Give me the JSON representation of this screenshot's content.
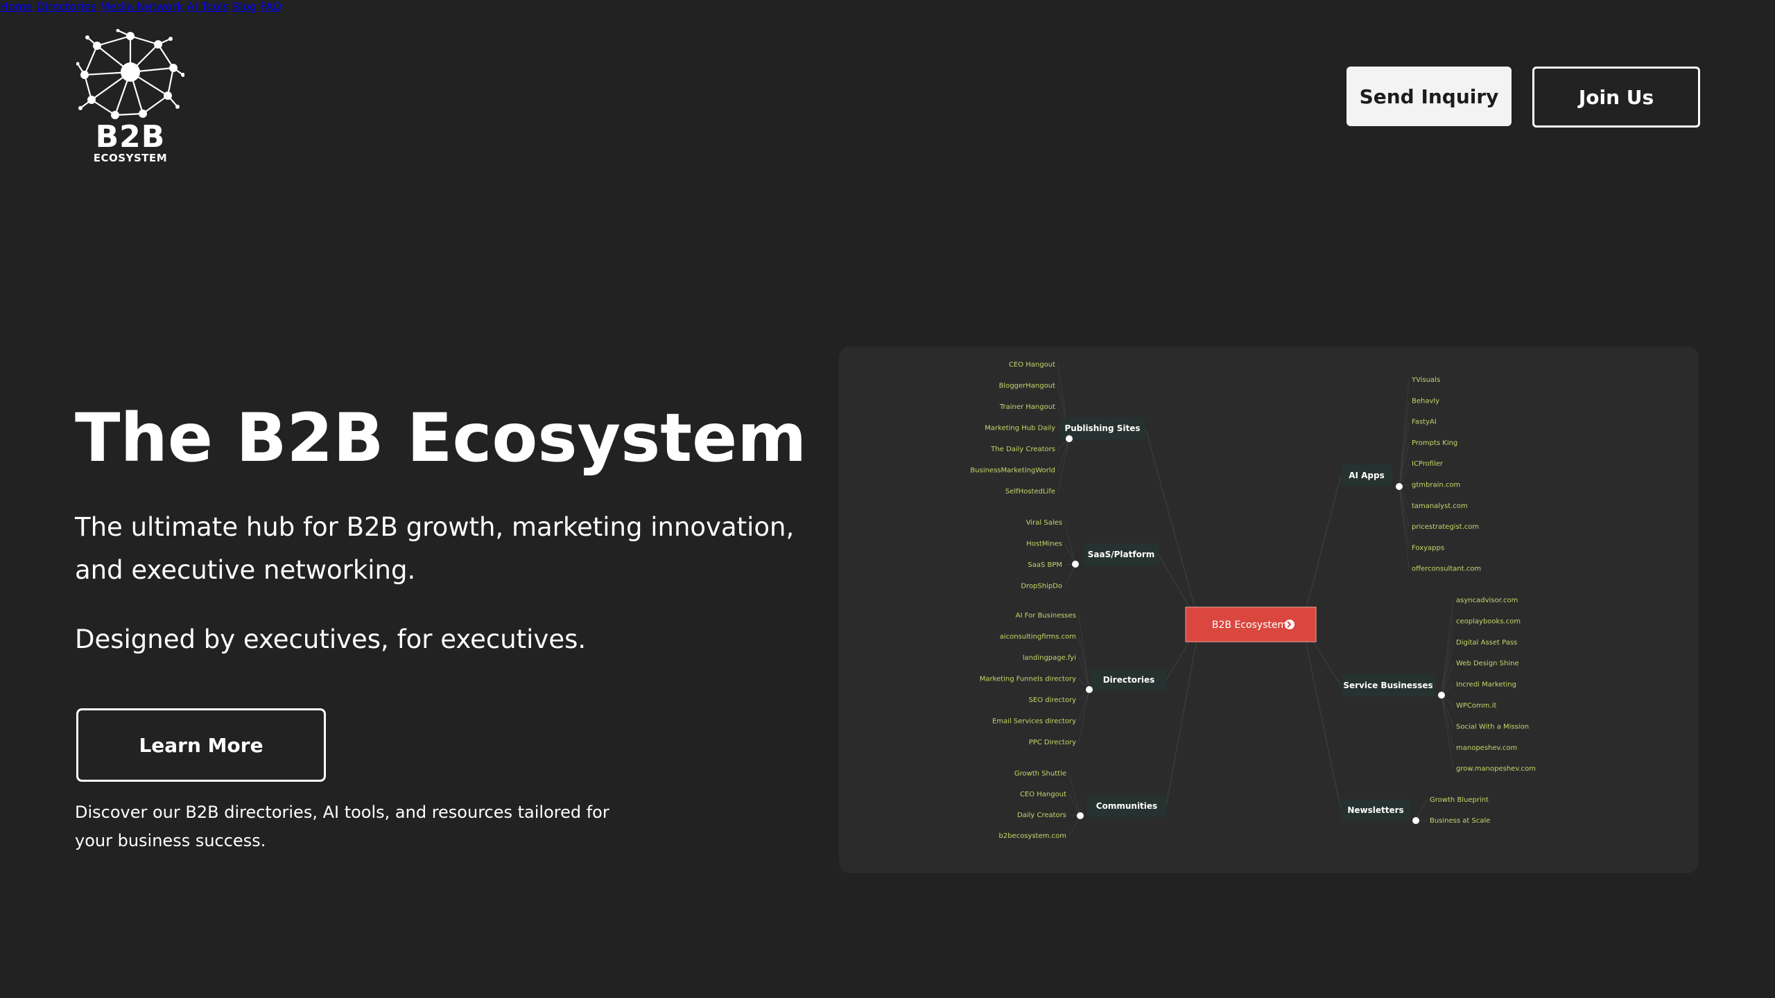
{
  "brand": {
    "name": "B2B",
    "subtitle": "ECOSYSTEM"
  },
  "nav": {
    "items": [
      {
        "label": "Home"
      },
      {
        "label": "Directories"
      },
      {
        "label": "Media Network"
      },
      {
        "label": "AI Tools"
      },
      {
        "label": "Blog"
      },
      {
        "label": "FAQ"
      }
    ],
    "send_inquiry_label": "Send Inquiry",
    "join_label": "Join Us"
  },
  "hero": {
    "title": "The B2B Ecosystem",
    "subtitle": "The ultimate hub for B2B growth, marketing innovation, and executive networking.",
    "tagline": "Designed by executives, for executives.",
    "learn_more_label": "Learn More",
    "discover_text": "Discover our B2B directories, AI tools, and resources tailored for your business success."
  },
  "mindmap": {
    "center": "B2B Ecosystem",
    "center_color": "#d9473f",
    "leaf_color": "#c8d66a",
    "categories": [
      {
        "name": "Publishing Sites",
        "items": [
          "CEO Hangout",
          "BloggerHangout",
          "Trainer Hangout",
          "Marketing Hub Daily",
          "The Daily Creators",
          "BusinessMarketingWorld",
          "SelfHostedLife"
        ]
      },
      {
        "name": "SaaS/Platform",
        "items": [
          "Viral Sales",
          "HostMines",
          "SaaS BPM",
          "DropShipDo"
        ]
      },
      {
        "name": "Directories",
        "items": [
          "AI For Businesses",
          "aiconsultingfirms.com",
          "landingpage.fyi",
          "Marketing Funnels directory",
          "SEO directory",
          "Email Services directory",
          "PPC Directory"
        ]
      },
      {
        "name": "Communities",
        "items": [
          "Growth Shuttle",
          "CEO Hangout",
          "Daily Creators",
          "b2becosystem.com"
        ]
      },
      {
        "name": "AI Apps",
        "items": [
          "YVisuals",
          "Behavly",
          "FastyAI",
          "Prompts King",
          "ICProfiler",
          "gtmbrain.com",
          "tamanalyst.com",
          "pricestrategist.com",
          "Foxyapps",
          "offerconsultant.com"
        ]
      },
      {
        "name": "Service Businesses",
        "items": [
          "asyncadvisor.com",
          "ceoplaybooks.com",
          "Digital Asset Pass",
          "Web Design Shine",
          "Incredi Marketing",
          "WPComm.it",
          "Social With a Mission",
          "manopeshev.com",
          "grow.manopeshev.com"
        ]
      },
      {
        "name": "Newsletters",
        "items": [
          "Growth Blueprint",
          "Business at Scale"
        ]
      }
    ]
  }
}
